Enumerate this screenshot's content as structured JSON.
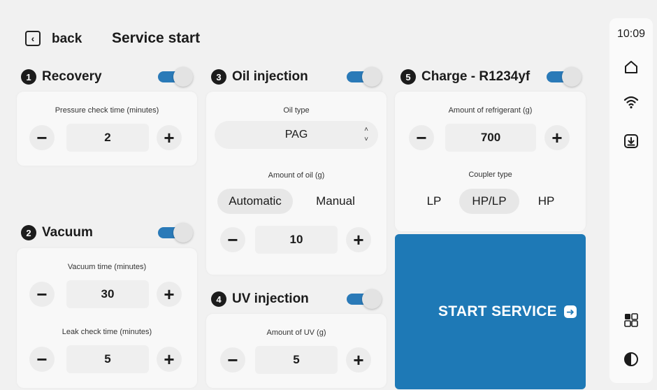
{
  "header": {
    "back_label": "back",
    "title": "Service start"
  },
  "sidebar": {
    "time": "10:09",
    "icons": [
      "home-icon",
      "wifi-icon",
      "download-icon",
      "grid-icon",
      "contrast-icon"
    ]
  },
  "colors": {
    "accent": "#1e79b6",
    "background": "#f1f1f1",
    "card": "#f8f8f8"
  },
  "sections": {
    "recovery": {
      "number": "1",
      "title": "Recovery",
      "enabled": true,
      "pressure_label": "Pressure check time (minutes)",
      "pressure_value": "2"
    },
    "vacuum": {
      "number": "2",
      "title": "Vacuum",
      "enabled": true,
      "vacuum_label": "Vacuum time (minutes)",
      "vacuum_value": "30",
      "leak_label": "Leak check time (minutes)",
      "leak_value": "5"
    },
    "oil": {
      "number": "3",
      "title": "Oil injection",
      "enabled": true,
      "type_label": "Oil type",
      "type_value": "PAG",
      "amount_label": "Amount of oil (g)",
      "mode_options": [
        "Automatic",
        "Manual"
      ],
      "mode_selected": "Automatic",
      "amount_value": "10"
    },
    "uv": {
      "number": "4",
      "title": "UV injection",
      "enabled": true,
      "amount_label": "Amount of UV (g)",
      "amount_value": "5"
    },
    "charge": {
      "number": "5",
      "title": "Charge - R1234yf",
      "enabled": true,
      "amount_label": "Amount of refrigerant (g)",
      "amount_value": "700",
      "coupler_label": "Coupler type",
      "coupler_options": [
        "LP",
        "HP/LP",
        "HP"
      ],
      "coupler_selected": "HP/LP"
    }
  },
  "controls": {
    "minus": "−",
    "plus": "+"
  },
  "start": {
    "label": "START SERVICE"
  }
}
